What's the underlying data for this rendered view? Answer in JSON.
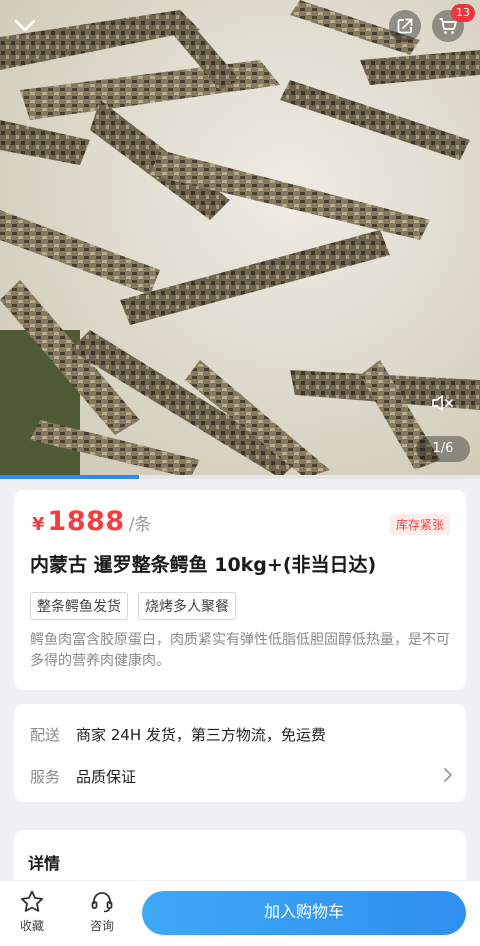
{
  "header": {
    "cart_badge": "13",
    "image_pager": "1/6",
    "icons": [
      "chevron-down-icon",
      "share-icon",
      "cart-icon",
      "mute-icon"
    ]
  },
  "gallery": {
    "current": 1,
    "total": 6,
    "progress": 0.29
  },
  "product": {
    "currency": "¥",
    "price": "1888",
    "unit": "/条",
    "stock_tag": "库存紧张",
    "title": "内蒙古 暹罗整条鳄鱼 10kg+(非当日达)",
    "tags": [
      "整条鳄鱼发货",
      "烧烤多人聚餐"
    ],
    "description": "鳄鱼肉富含胶原蛋白，肉质紧实有弹性低脂低胆固醇低热量，是不可多得的营养肉健康肉。"
  },
  "delivery": {
    "shipping_label": "配送",
    "shipping_value": "商家 24H 发货，第三方物流，免运费",
    "service_label": "服务",
    "service_value": "品质保证"
  },
  "details": {
    "title": "详情"
  },
  "bottom_bar": {
    "favorite_label": "收藏",
    "consult_label": "咨询",
    "add_to_cart": "加入购物车"
  },
  "colors": {
    "price_red": "#f23e3e",
    "accent_blue": "#2f8ff0",
    "badge_red": "#f0353c"
  }
}
